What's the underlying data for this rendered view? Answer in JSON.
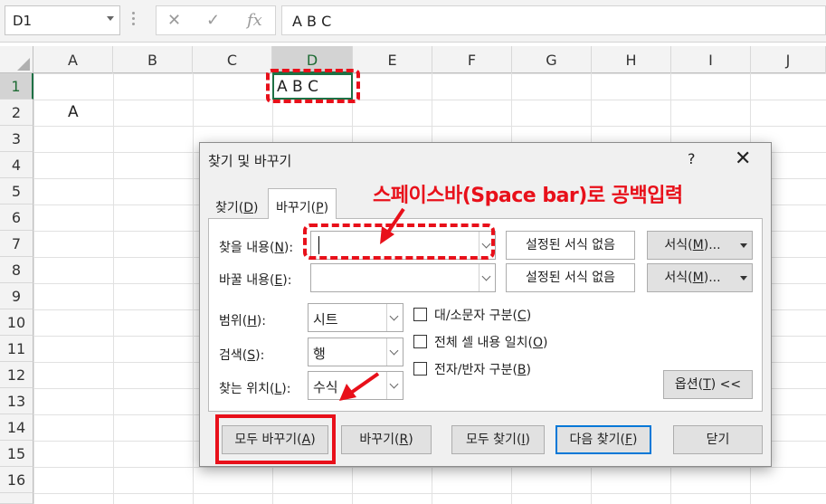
{
  "formula_bar": {
    "name_box": "D1",
    "cancel_icon": "x-icon",
    "enter_icon": "check-icon",
    "function_icon_text": "fx",
    "formula_value": "A B C"
  },
  "grid": {
    "columns": [
      "A",
      "B",
      "C",
      "D",
      "E",
      "F",
      "G",
      "H",
      "I",
      "J"
    ],
    "rows": [
      "1",
      "2",
      "3",
      "4",
      "5",
      "6",
      "7",
      "8",
      "9",
      "10",
      "11",
      "12",
      "13",
      "14",
      "15",
      "16"
    ],
    "active_column": "D",
    "active_row": "1",
    "cells": {
      "D1": "A B C",
      "A2": "A"
    }
  },
  "dialog": {
    "title": "찾기 및 바꾸기",
    "help": "?",
    "close": "✕",
    "tabs": [
      {
        "label_pre": "찾기(",
        "key": "D",
        "label_post": ")"
      },
      {
        "label_pre": "바꾸기(",
        "key": "P",
        "label_post": ")"
      }
    ],
    "find": {
      "label_pre": "찾을 내용(",
      "key": "N",
      "label_post": "):",
      "value": "",
      "format_preview": "설정된 서식 없음",
      "format_button": {
        "pre": "서식(",
        "key": "M",
        "post": ")..."
      }
    },
    "replace": {
      "label_pre": "바꿀 내용(",
      "key": "E",
      "label_post": "):",
      "value": "",
      "format_preview": "설정된 서식 없음",
      "format_button": {
        "pre": "서식(",
        "key": "M",
        "post": ")..."
      }
    },
    "options": {
      "within": {
        "label_pre": "범위(",
        "key": "H",
        "label_post": "):",
        "value": "시트"
      },
      "search": {
        "label_pre": "검색(",
        "key": "S",
        "label_post": "):",
        "value": "행"
      },
      "look_in": {
        "label_pre": "찾는 위치(",
        "key": "L",
        "label_post": "):",
        "value": "수식"
      },
      "match_case": {
        "label_pre": "대/소문자 구분(",
        "key": "C",
        "label_post": ")",
        "checked": false
      },
      "match_entire": {
        "label_pre": "전체 셀 내용 일치(",
        "key": "O",
        "label_post": ")",
        "checked": false
      },
      "match_byte": {
        "label_pre": "전자/반자 구분(",
        "key": "B",
        "label_post": ")",
        "checked": false
      },
      "options_button": {
        "pre": "옵션(",
        "key": "T",
        "post": ") <<"
      }
    },
    "buttons": {
      "replace_all": {
        "pre": "모두 바꾸기(",
        "key": "A",
        "post": ")"
      },
      "replace": {
        "pre": "바꾸기(",
        "key": "R",
        "post": ")"
      },
      "find_all": {
        "pre": "모두 찾기(",
        "key": "I",
        "post": ")"
      },
      "find_next": {
        "pre": "다음 찾기(",
        "key": "F",
        "post": ")"
      },
      "close": "닫기"
    }
  },
  "annotation": {
    "text": "스페이스바(Space bar)로 공백입력",
    "color": "#e8101a"
  }
}
